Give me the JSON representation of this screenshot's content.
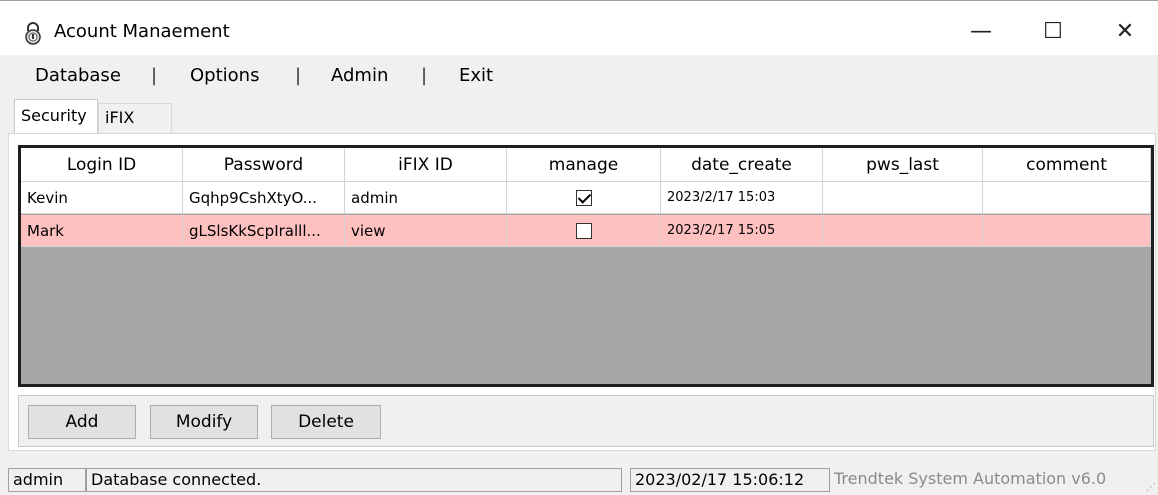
{
  "window": {
    "title": "Acount Manaement",
    "controls": {
      "minimize": "—",
      "maximize": "☐",
      "close": "✕"
    }
  },
  "menu": {
    "items": [
      "Database",
      "Options",
      "Admin",
      "Exit"
    ],
    "separator": "|"
  },
  "tabs": [
    {
      "label": "Security",
      "active": true
    },
    {
      "label": "iFIX",
      "active": false
    }
  ],
  "grid": {
    "columns": [
      "Login ID",
      "Password",
      "iFIX ID",
      "manage",
      "date_create",
      "pws_last",
      "comment"
    ],
    "rows": [
      {
        "login_id": "Kevin",
        "password": "Gqhp9CshXtyO...",
        "ifix_id": "admin",
        "manage": true,
        "date_create": "2023/2/17 15:03",
        "pws_last": "",
        "comment": "",
        "highlight": "#ffffff"
      },
      {
        "login_id": "Mark",
        "password": "gLSlsKkScpIralll...",
        "ifix_id": "view",
        "manage": false,
        "date_create": "2023/2/17 15:05",
        "pws_last": "",
        "comment": "",
        "highlight": "#ffc0c0"
      }
    ]
  },
  "buttons": {
    "add": "Add",
    "modify": "Modify",
    "delete": "Delete"
  },
  "status": {
    "user": "admin",
    "message": "Database connected.",
    "datetime": "2023/02/17 15:06:12",
    "company": "Trendtek System Automation v6.0"
  },
  "colors": {
    "selected_row": "#ffc0c0",
    "grid_bg": "#a6a6a6",
    "window_bg": "#f0f0f0"
  }
}
